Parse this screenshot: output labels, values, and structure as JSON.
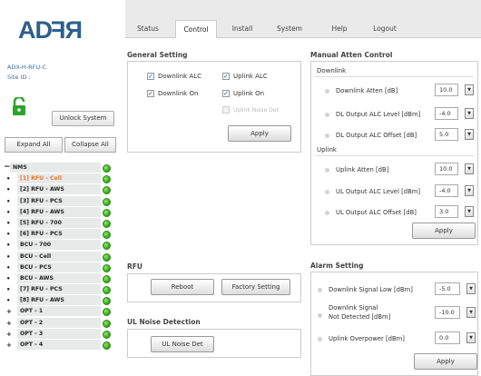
{
  "brand": {
    "logo_left": "AD",
    "logo_right": "RF"
  },
  "device": {
    "model": "ADX-H-RFU-C",
    "site_label": "Site ID :"
  },
  "sidebar": {
    "unlock_label": "Unlock System",
    "expand_label": "Expand All",
    "collapse_label": "Collapse All",
    "tree": [
      {
        "bullet": "−",
        "label": "NMS"
      },
      {
        "bullet": "•",
        "label": "[1] RFU - Cell"
      },
      {
        "bullet": "•",
        "label": "[2] RFU - AWS"
      },
      {
        "bullet": "•",
        "label": "[3] RFU - PCS"
      },
      {
        "bullet": "•",
        "label": "[4] RFU - AWS"
      },
      {
        "bullet": "•",
        "label": "[5] RFU - 700"
      },
      {
        "bullet": "•",
        "label": "[6] RFU - PCS"
      },
      {
        "bullet": "•",
        "label": "BCU - 700"
      },
      {
        "bullet": "•",
        "label": "BCU - Cell"
      },
      {
        "bullet": "•",
        "label": "BCU - PCS"
      },
      {
        "bullet": "•",
        "label": "BCU - AWS"
      },
      {
        "bullet": "•",
        "label": "[7] RFU - PCS"
      },
      {
        "bullet": "•",
        "label": "[8] RFU - AWS"
      },
      {
        "bullet": "+",
        "label": "OPT - 1"
      },
      {
        "bullet": "+",
        "label": "OPT - 2"
      },
      {
        "bullet": "+",
        "label": "OPT - 3"
      },
      {
        "bullet": "+",
        "label": "OPT - 4"
      }
    ]
  },
  "nav": {
    "tabs": [
      "Status",
      "Control",
      "Install",
      "System",
      "Help",
      "Logout"
    ],
    "active": "Control"
  },
  "general": {
    "title": "General Setting",
    "downlink_alc": "Downlink ALC",
    "uplink_alc": "Uplink ALC",
    "downlink_on": "Downlink On",
    "uplink_on": "Uplink On",
    "uplink_noise_det": "Uplink Noise Det",
    "apply": "Apply"
  },
  "manual_atten": {
    "title": "Manual Atten Control",
    "downlink_header": "Downlink",
    "uplink_header": "Uplink",
    "rows_dl": [
      {
        "label": "Downlink Atten [dB]",
        "value": "10.0"
      },
      {
        "label": "DL Output ALC Level [dBm]",
        "value": "-4.0"
      },
      {
        "label": "DL Output ALC Offset [dB]",
        "value": "5.0"
      }
    ],
    "rows_ul": [
      {
        "label": "Uplink Atten [dB]",
        "value": "10.0"
      },
      {
        "label": "UL Output ALC Level [dBm]",
        "value": "-4.0"
      },
      {
        "label": "UL Output ALC Offset [dB]",
        "value": "3.0"
      }
    ],
    "apply": "Apply"
  },
  "rfu": {
    "title": "RFU",
    "reboot": "Reboot",
    "factory": "Factory Setting"
  },
  "noise": {
    "title": "UL Noise Detection",
    "button": "UL Noise Det"
  },
  "alarm": {
    "title": "Alarm Setting",
    "low_label": "Downlink Signal Low [dBm]",
    "low_value": "-5.0",
    "nd_label1": "Downlink Signal",
    "nd_label2": "Not Detected [dBm]",
    "nd_value": "-10.0",
    "over_label": "Uplink Overpower [dBm]",
    "over_value": "0.0",
    "apply": "Apply"
  },
  "colors": {
    "accent": "#2e5f8e",
    "selected": "#e9772a",
    "status_ok": "#2ea315"
  }
}
